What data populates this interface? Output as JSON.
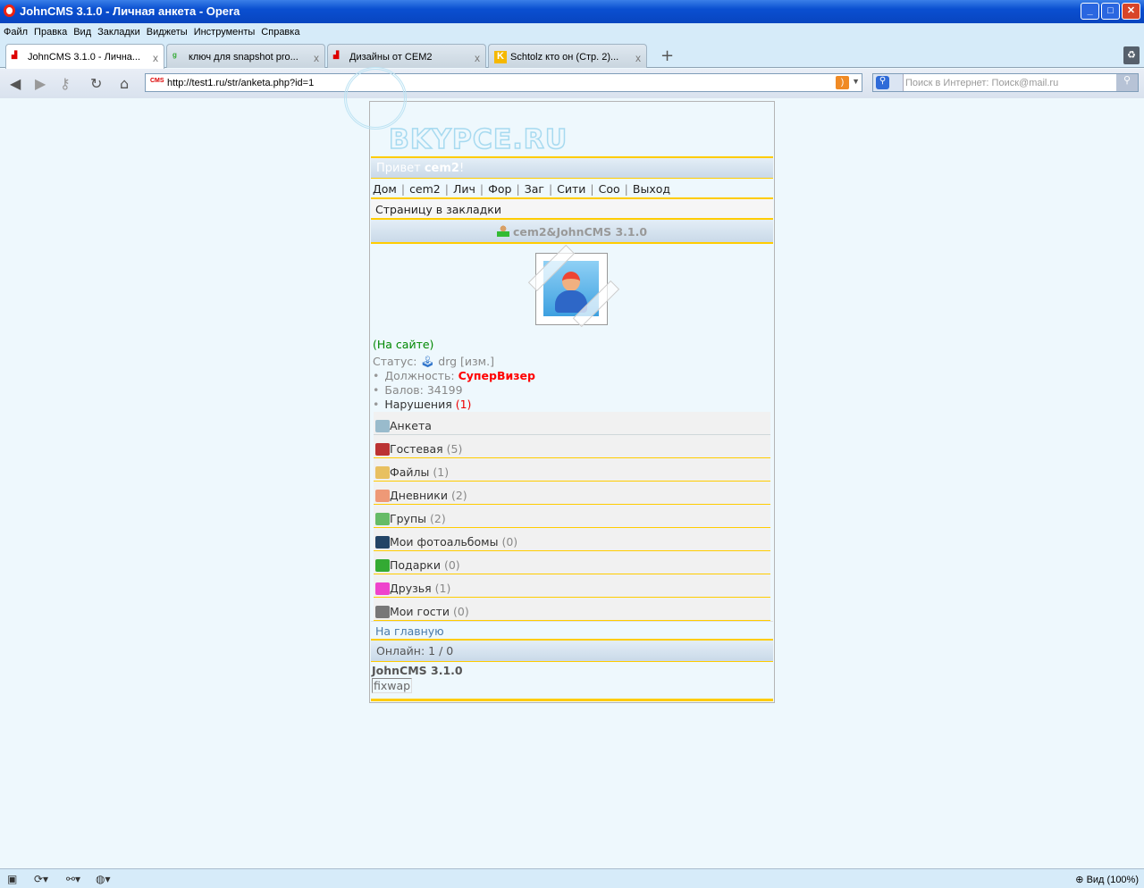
{
  "window": {
    "title": "JohnCMS 3.1.0 - Личная анкета - Opera"
  },
  "menu": [
    "Файл",
    "Правка",
    "Вид",
    "Закладки",
    "Виджеты",
    "Инструменты",
    "Справка"
  ],
  "tabs": [
    {
      "label": "JohnCMS 3.1.0 - Лична...",
      "active": true
    },
    {
      "label": "ключ для snapshot pro...",
      "active": false
    },
    {
      "label": "Дизайны от CEM2",
      "active": false
    },
    {
      "label": "Schtolz кто он (Стр. 2)...",
      "active": false
    }
  ],
  "address": {
    "url": "http://test1.ru/str/anketa.php?id=1"
  },
  "search": {
    "placeholder": "Поиск в Интернет: Поиск@mail.ru"
  },
  "site": {
    "logo": "BKYPCE.RU",
    "greeting": "Привет ",
    "username": "cem2",
    "greeting_end": "!",
    "nav": [
      "Дом",
      "cem2",
      "Лич",
      "Фор",
      "Заг",
      "Сити",
      "Соо",
      "Выход"
    ],
    "bookmark": "Страницу в закладки",
    "profile_title": "cem2&JohnCMS 3.1.0",
    "online_status": "(На сайте)",
    "status_label": "Статус: ",
    "status_value": "drg [изм.]",
    "position_label": "Должность: ",
    "position_value": "СуперВизер",
    "points_label": "Балов: ",
    "points_value": "34199",
    "violations_label": "Нарушения ",
    "violations_value": "(1)",
    "items": [
      {
        "label": "Анкета",
        "count": "",
        "icon": "profile-card-icon"
      },
      {
        "label": "Гостевая",
        "count": "(5)",
        "icon": "guestbook-icon"
      },
      {
        "label": "Файлы",
        "count": "(1)",
        "icon": "files-icon"
      },
      {
        "label": "Дневники",
        "count": "(2)",
        "icon": "pencil-icon"
      },
      {
        "label": "Групы",
        "count": "(2)",
        "icon": "groups-icon"
      },
      {
        "label": "Мои фотоальбомы",
        "count": "(0)",
        "icon": "camera-icon"
      },
      {
        "label": "Подарки",
        "count": "(0)",
        "icon": "gift-icon"
      },
      {
        "label": "Друзья",
        "count": "(1)",
        "icon": "friends-gift-icon"
      },
      {
        "label": "Мои гости",
        "count": "(0)",
        "icon": "guest-icon"
      }
    ],
    "home": "На главную",
    "online": "Онлайн: 1 / 0",
    "footer_title": "JohnCMS 3.1.0",
    "footer_link": "fixwap"
  },
  "statusbar": {
    "zoom": "Вид (100%)"
  }
}
